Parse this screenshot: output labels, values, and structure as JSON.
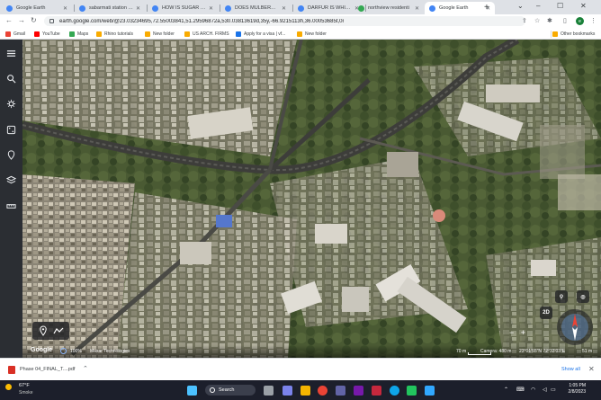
{
  "browser": {
    "tabs": [
      {
        "title": "Google Earth",
        "color": "#4285f4",
        "active": false
      },
      {
        "title": "sabarmati station ah",
        "color": "#4285f4",
        "active": false
      },
      {
        "title": "HOW IS SUGAR MA",
        "color": "#4285f4",
        "active": false
      },
      {
        "title": "DOES MULBERRY GR",
        "color": "#4285f4",
        "active": false
      },
      {
        "title": "DARFUR IS WHICH C",
        "color": "#4285f4",
        "active": false
      },
      {
        "title": "northview residenti",
        "color": "#34a853",
        "active": false
      },
      {
        "title": "Google Earth",
        "color": "#4285f4",
        "active": true
      }
    ],
    "new_tab": "+",
    "address": {
      "url": "earth.google.com/web/@23.03234695,72.55003841,51.29596872a,530.03813619d,35y,-66.9215113h,36.00053685t,0r"
    },
    "profile_initial": "e",
    "bookmarks": [
      {
        "label": "Gmail",
        "color": "#ea4335"
      },
      {
        "label": "YouTube",
        "color": "#ff0000"
      },
      {
        "label": "Maps",
        "color": "#34a853"
      },
      {
        "label": "Rhino tutorials",
        "color": "#f9ab00"
      },
      {
        "label": "New folder",
        "color": "#f9ab00"
      },
      {
        "label": "US ARCH. FIRMS",
        "color": "#f9ab00"
      },
      {
        "label": "Apply for a visa | vf...",
        "color": "#1a73e8"
      },
      {
        "label": "New folder",
        "color": "#f9ab00"
      }
    ],
    "other_bookmarks": "Other bookmarks"
  },
  "earth": {
    "left_toolbar": [
      "menu-icon",
      "search-icon",
      "voyager-icon",
      "feeling-lucky-icon",
      "projects-icon",
      "map-style-icon",
      "measure-icon"
    ],
    "mode_toggle": "2D",
    "status": {
      "google": "Google",
      "zoom": "100%",
      "attribution": "Maxar Technologies",
      "scale": "70 m",
      "camera": "Camera: 480 m",
      "coords": "23°01'55\"N 72°33'03\"E",
      "elevation": "51 m"
    }
  },
  "downloads": {
    "file": "Phase 04_FINAL_T....pdf",
    "show_all": "Show all"
  },
  "taskbar": {
    "temp": "67°F",
    "condition": "Smoke",
    "search": "Search",
    "time": "1:05 PM",
    "date": "2/8/2023",
    "apps": [
      {
        "name": "windows-start",
        "color": "#4cc2ff"
      },
      {
        "name": "file-explorer",
        "color": "#f9c74f"
      },
      {
        "name": "task-view",
        "color": "#9aa0a6"
      },
      {
        "name": "chat",
        "color": "#7b83eb"
      },
      {
        "name": "explorer-folder",
        "color": "#f4b400"
      },
      {
        "name": "chrome",
        "color": "#ea4335"
      },
      {
        "name": "teams",
        "color": "#6264a7"
      },
      {
        "name": "onenote",
        "color": "#7719aa"
      },
      {
        "name": "mail",
        "color": "#c5283d"
      },
      {
        "name": "edge",
        "color": "#0ea5e9"
      },
      {
        "name": "media",
        "color": "#22c55e"
      },
      {
        "name": "photoshop",
        "color": "#31a8ff"
      }
    ]
  }
}
